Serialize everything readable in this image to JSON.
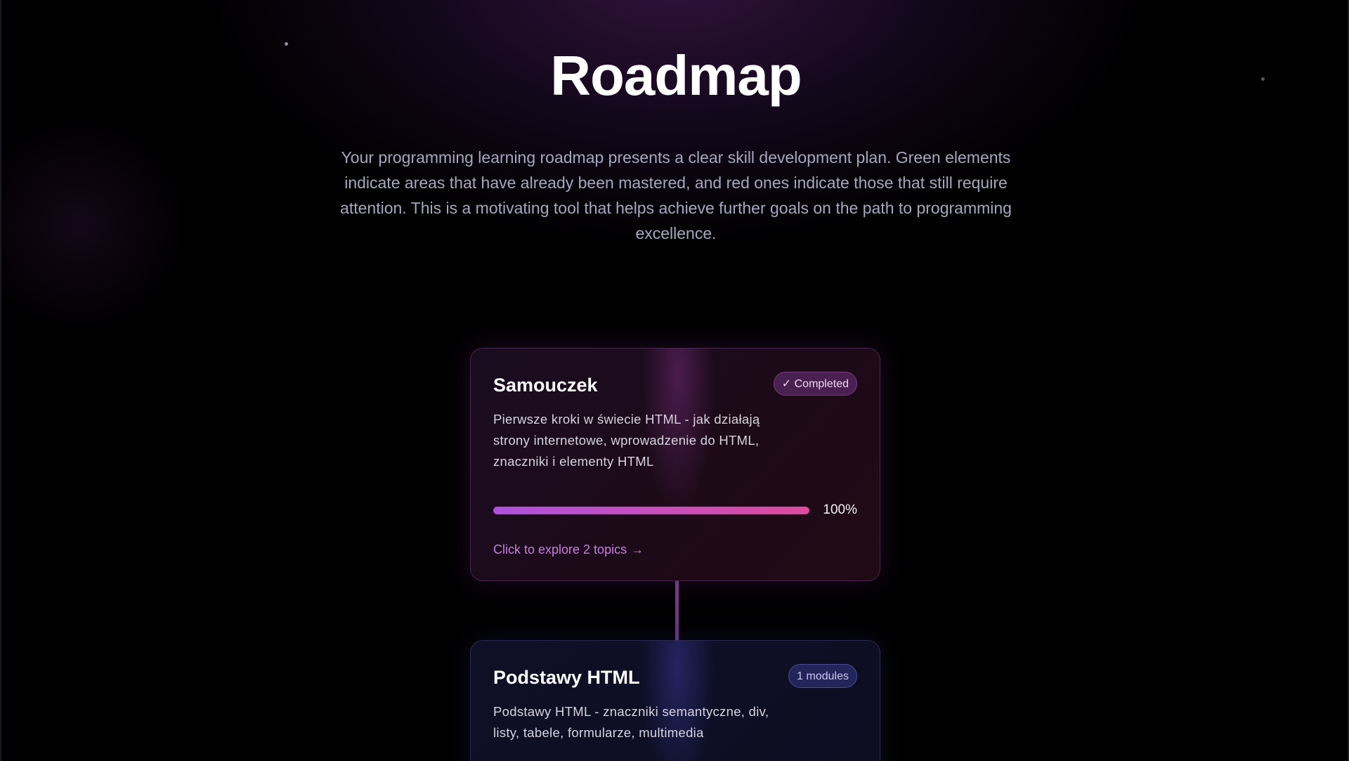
{
  "hero": {
    "title": "Roadmap",
    "description": "Your programming learning roadmap presents a clear skill development plan. Green elements indicate areas that have already been mastered, and red ones indicate those that still require attention. This is a motivating tool that helps achieve further goals on the path to programming excellence."
  },
  "cards": [
    {
      "title": "Samouczek",
      "badge": "✓ Completed",
      "description": "Pierwsze kroki w świecie HTML - jak działają strony internetowe, wprowadzenie do HTML, znaczniki i elementy HTML",
      "progress": 100,
      "progress_label": "100%",
      "link_text": "Click to explore 2 topics",
      "link_arrow": "→"
    },
    {
      "title": "Podstawy HTML",
      "badge": "1 modules",
      "description": "Podstawy HTML - znaczniki semantyczne, div, listy, tabele, formularze, multimedia"
    }
  ],
  "colors": {
    "accent_purple": "#b050e0",
    "accent_pink": "#e04aa0",
    "link": "#c97ee6"
  }
}
